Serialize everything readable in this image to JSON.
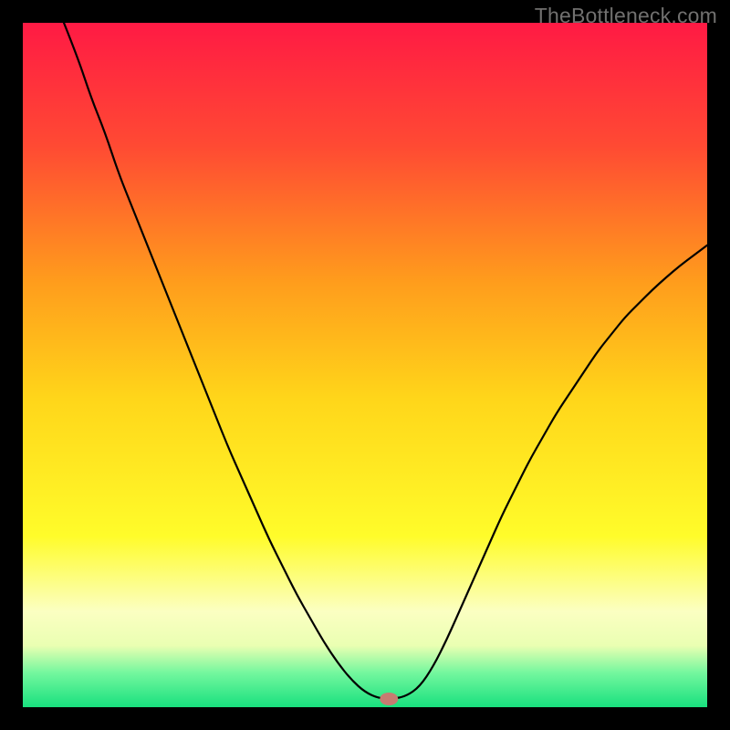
{
  "watermark": "TheBottleneck.com",
  "chart_data": {
    "type": "line",
    "title": "",
    "xlabel": "",
    "ylabel": "",
    "xlim": [
      0,
      100
    ],
    "ylim": [
      0,
      100
    ],
    "grid": false,
    "legend": false,
    "gradient_stops": [
      {
        "offset": 0.0,
        "color": "#ff1a44"
      },
      {
        "offset": 0.18,
        "color": "#ff4a33"
      },
      {
        "offset": 0.38,
        "color": "#ff9d1c"
      },
      {
        "offset": 0.55,
        "color": "#ffd61a"
      },
      {
        "offset": 0.75,
        "color": "#fffc2a"
      },
      {
        "offset": 0.86,
        "color": "#fbffc2"
      },
      {
        "offset": 0.91,
        "color": "#eaffb2"
      },
      {
        "offset": 0.95,
        "color": "#73f79e"
      },
      {
        "offset": 1.0,
        "color": "#18e07e"
      }
    ],
    "series": [
      {
        "name": "bottleneck-curve",
        "color": "#000000",
        "x": [
          6,
          8,
          10,
          12,
          14,
          16,
          18,
          20,
          22,
          24,
          26,
          28,
          30,
          32,
          34,
          36,
          38,
          40,
          42,
          44,
          46,
          48,
          50,
          52,
          54,
          56,
          58,
          60,
          62,
          64,
          66,
          68,
          70,
          72,
          74,
          76,
          78,
          80,
          82,
          84,
          86,
          88,
          90,
          92,
          94,
          96,
          98,
          100
        ],
        "y": [
          100,
          95,
          89,
          84,
          78,
          73,
          68,
          63,
          58,
          53,
          48,
          43,
          38,
          33.5,
          29,
          24.5,
          20.5,
          16.5,
          13,
          9.5,
          6.5,
          4,
          2.2,
          1.3,
          1.2,
          1.6,
          3.0,
          6.0,
          10,
          14.5,
          19,
          23.5,
          28,
          32,
          36,
          39.5,
          43,
          46,
          49,
          52,
          54.5,
          57,
          59,
          61,
          62.8,
          64.5,
          66,
          67.5
        ]
      }
    ],
    "marker": {
      "x": 53.5,
      "y": 1.2,
      "color": "#c77b71"
    }
  }
}
